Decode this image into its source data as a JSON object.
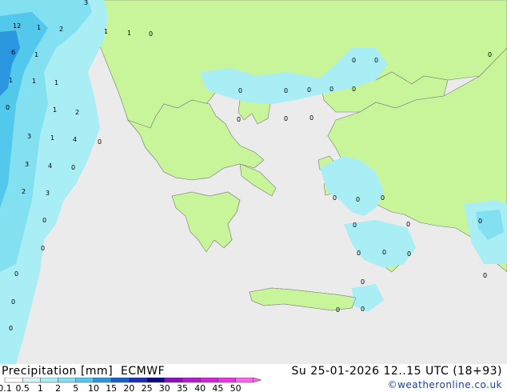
{
  "footer": {
    "title_left": "Precipitation [mm]  ECMWF",
    "title_right": "Su 25-01-2026 12..15 UTC (18+93)",
    "credit": "©weatheronline.co.uk"
  },
  "legend": {
    "ticks": [
      "0.1",
      "0.5",
      "1",
      "2",
      "5",
      "10",
      "15",
      "20",
      "25",
      "30",
      "35",
      "40",
      "45",
      "50"
    ],
    "colors": [
      "#ffffff",
      "#d9f4f8",
      "#aaeef5",
      "#82e0f0",
      "#52c8ec",
      "#2a96e0",
      "#1a5fd0",
      "#1c2fb8",
      "#0c0c80",
      "#8a10c0",
      "#b818d0",
      "#d820d8",
      "#f030e8",
      "#ff60f0"
    ]
  },
  "colors": {
    "sea": "#ebebeb",
    "land": "#c8f59a",
    "precip_light": "#aaeef5",
    "precip_mid": "#82e0f0",
    "precip_heavy": "#52c8ec",
    "precip_blue": "#2a96e0"
  },
  "map": {
    "value_labels": [
      "3",
      "12",
      "1",
      "2",
      "1",
      "1",
      "0",
      "6",
      "1",
      "1",
      "1",
      "1",
      "0",
      "2",
      "1",
      "3",
      "1",
      "4",
      "0",
      "3",
      "4",
      "0",
      "2",
      "3",
      "0",
      "0",
      "0",
      "0",
      "0",
      "0",
      "0",
      "0",
      "0",
      "0",
      "0",
      "0",
      "0",
      "0",
      "0",
      "0",
      "0",
      "0",
      "0",
      "0",
      "0",
      "0",
      "0",
      "0",
      "0",
      "0",
      "0",
      "0",
      "0"
    ]
  }
}
